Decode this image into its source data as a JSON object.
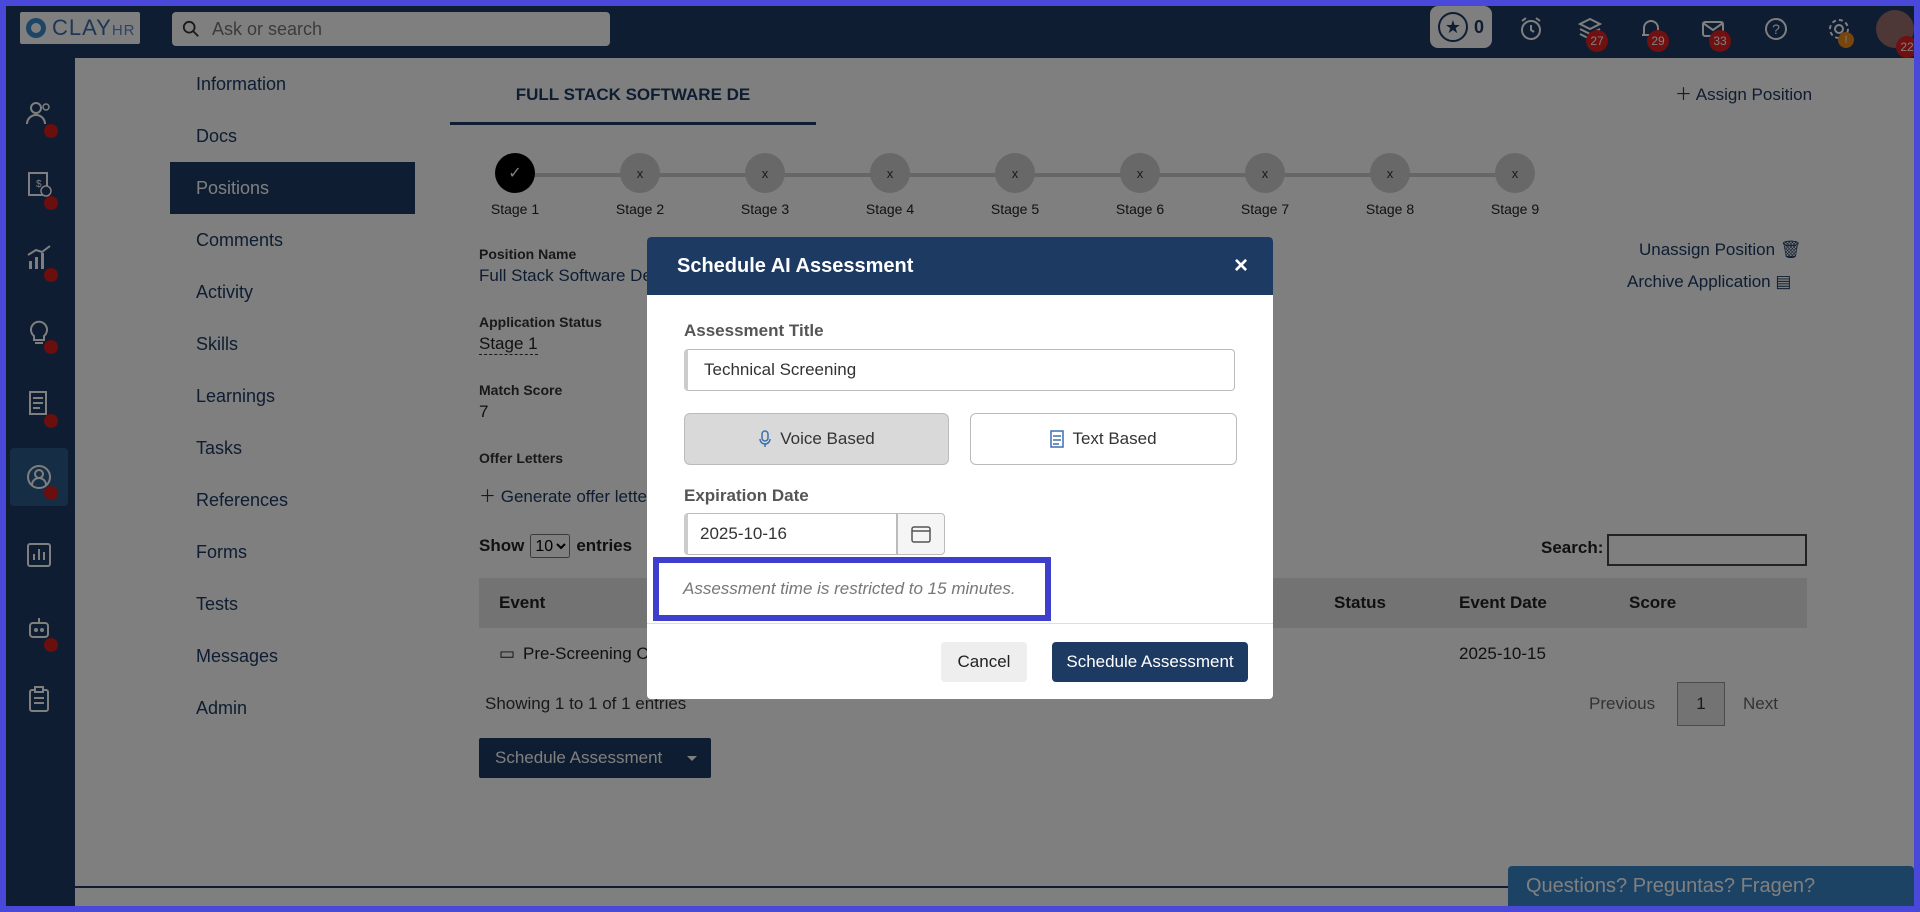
{
  "topbar": {
    "logo_text": "CLAY",
    "logo_suffix": "HR",
    "search_placeholder": "Ask or search",
    "points": "0",
    "badges": {
      "stack": "27",
      "bell": "29",
      "mail": "33",
      "settings": "!",
      "avatar": "22"
    }
  },
  "submenu": {
    "items": [
      "Information",
      "Docs",
      "Positions",
      "Comments",
      "Activity",
      "Skills",
      "Learnings",
      "Tasks",
      "References",
      "Forms",
      "Tests",
      "Messages",
      "Admin"
    ],
    "active": "Positions"
  },
  "position": {
    "tab_label": "FULL STACK SOFTWARE DE",
    "assign_label": "Assign Position",
    "unassign_label": "Unassign Position",
    "archive_label": "Archive Application",
    "stages": [
      "Stage 1",
      "Stage 2",
      "Stage 3",
      "Stage 4",
      "Stage 5",
      "Stage 6",
      "Stage 7",
      "Stage 8",
      "Stage 9"
    ],
    "stage_done_mark": "✓",
    "stage_pending_mark": "x",
    "name_label": "Position Name",
    "name_value": "Full Stack Software De",
    "status_label": "Application Status",
    "status_value": "Stage 1",
    "match_label": "Match Score",
    "match_value": "7",
    "offer_label": "Offer Letters",
    "offer_link": "Generate offer lette"
  },
  "table": {
    "show_label": "Show",
    "entries_label": "entries",
    "page_size": "10",
    "search_label": "Search:",
    "headers": {
      "event": "Event",
      "status": "Status",
      "event_date": "Event Date",
      "score": "Score"
    },
    "rows": [
      {
        "event": "Pre-Screening Ca",
        "event_date": "2025-10-15"
      }
    ],
    "showing": "Showing 1 to 1 of 1 entries",
    "prev": "Previous",
    "page": "1",
    "next": "Next"
  },
  "schedule_button": "Schedule Assessment",
  "help_bar": "Questions? Preguntas? Fragen?",
  "modal": {
    "title": "Schedule AI Assessment",
    "title_label": "Assessment Title",
    "title_value": "Technical Screening",
    "voice_label": "Voice Based",
    "text_label": "Text Based",
    "selected_mode": "Voice Based",
    "expiration_label": "Expiration Date",
    "expiration_value": "2025-10-16",
    "note": "Assessment time is restricted to 15 minutes.",
    "cancel_label": "Cancel",
    "submit_label": "Schedule Assessment"
  },
  "colors": {
    "navy": "#1d3a63",
    "highlight": "#3f3fce",
    "badge": "#e02020",
    "help": "#3a86c8"
  }
}
